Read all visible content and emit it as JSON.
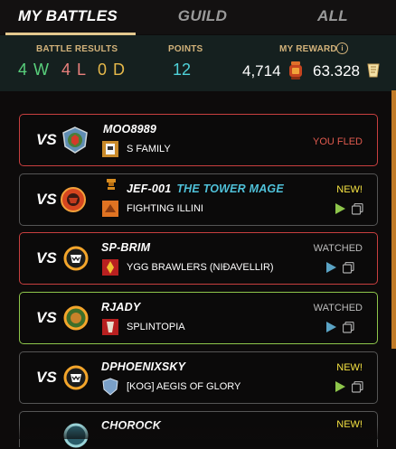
{
  "tabs": {
    "my_battles": "MY BATTLES",
    "guild": "GUILD",
    "all": "ALL"
  },
  "stats": {
    "battle_results_label": "BATTLE RESULTS",
    "points_label": "POINTS",
    "my_reward_label": "MY REWARD",
    "wins": "4 W",
    "losses": "4 L",
    "draws": "0 D",
    "points": "12",
    "dec": "4,714",
    "sps": "63.328"
  },
  "vs_label": "VS",
  "battles": [
    {
      "player": "MOO8989",
      "title": "",
      "guild": "S FAMILY",
      "status": "YOU FLED",
      "result": "loss"
    },
    {
      "player": "JEF-001",
      "title": "THE TOWER MAGE",
      "guild": "FIGHTING ILLINI",
      "status": "NEW!",
      "result": "unknown"
    },
    {
      "player": "SP-BRIM",
      "title": "",
      "guild": "YGG BRAWLERS (NIÐAVELLIR)",
      "status": "WATCHED",
      "result": "loss"
    },
    {
      "player": "RJADY",
      "title": "",
      "guild": "SPLINTOPIA",
      "status": "WATCHED",
      "result": "win"
    },
    {
      "player": "DPHOENIXSKY",
      "title": "",
      "guild": "[KOG] AEGIS OF GLORY",
      "status": "NEW!",
      "result": "unknown"
    },
    {
      "player": "CHOROCK",
      "title": "",
      "guild": "",
      "status": "NEW!",
      "result": "unknown"
    }
  ],
  "colors": {
    "accent": "#e3c88e",
    "win": "#59d07c",
    "loss": "#e9807c",
    "draw": "#e5b84a",
    "points": "#4fd2d9",
    "new": "#f7e442",
    "fled": "#e05a4e"
  }
}
